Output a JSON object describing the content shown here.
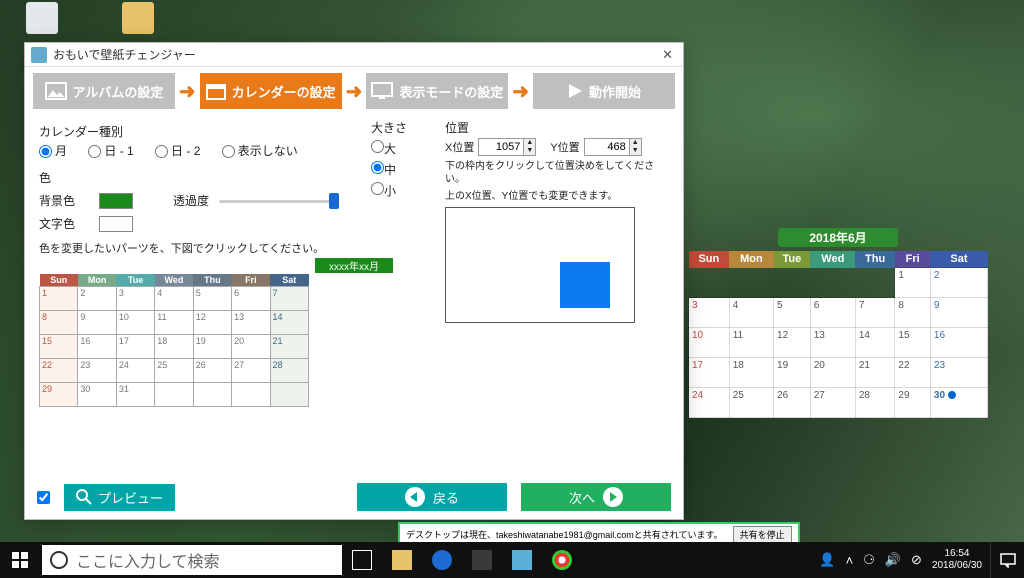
{
  "desktop": {
    "icons": {
      "recycle": "ごみ箱"
    }
  },
  "share_bar": {
    "text": "デスクトップは現在、takeshiwatanabe1981@gmail.comと共有されています。",
    "stop": "共有を停止"
  },
  "window": {
    "title": "おもいで壁紙チェンジャー",
    "steps": {
      "album": "アルバムの設定",
      "calendar": "カレンダーの設定",
      "display": "表示モードの設定",
      "start": "動作開始"
    },
    "cal_type": {
      "label": "カレンダー種別",
      "opts": {
        "month": "月",
        "day1": "日 - 1",
        "day2": "日 - 2",
        "none": "表示しない"
      },
      "selected": "month"
    },
    "color": {
      "label": "色",
      "bg": "背景色",
      "fg": "文字色",
      "opacity": "透過度",
      "note": "色を変更したいパーツを、下図でクリックしてください。",
      "mini_title": "xxxx年xx月",
      "headers": [
        "Sun",
        "Mon",
        "Tue",
        "Wed",
        "Thu",
        "Fri",
        "Sat"
      ]
    },
    "size": {
      "label": "大きさ",
      "opts": {
        "lg": "大",
        "md": "中",
        "sm": "小"
      },
      "selected": "md"
    },
    "position": {
      "label": "位置",
      "x_label": "X位置",
      "y_label": "Y位置",
      "x": "1057",
      "y": "468",
      "note1": "下の枠内をクリックして位置決めをしてください。",
      "note2": "上のX位置、Y位置でも変更できます。"
    },
    "buttons": {
      "preview": "プレビュー",
      "back": "戻る",
      "next": "次へ"
    }
  },
  "desk_calendar": {
    "title": "2018年6月",
    "headers": [
      "Sun",
      "Mon",
      "Tue",
      "Wed",
      "Thu",
      "Fri",
      "Sat"
    ],
    "weeks": [
      [
        "",
        "",
        "",
        "",
        "",
        "1",
        "2"
      ],
      [
        "3",
        "4",
        "5",
        "6",
        "7",
        "8",
        "9"
      ],
      [
        "10",
        "11",
        "12",
        "13",
        "14",
        "15",
        "16"
      ],
      [
        "17",
        "18",
        "19",
        "20",
        "21",
        "22",
        "23"
      ],
      [
        "24",
        "25",
        "26",
        "27",
        "28",
        "29",
        "30"
      ]
    ],
    "today": "30"
  },
  "taskbar": {
    "search_placeholder": "ここに入力して検索",
    "time": "16:54",
    "date": "2018/06/30"
  }
}
